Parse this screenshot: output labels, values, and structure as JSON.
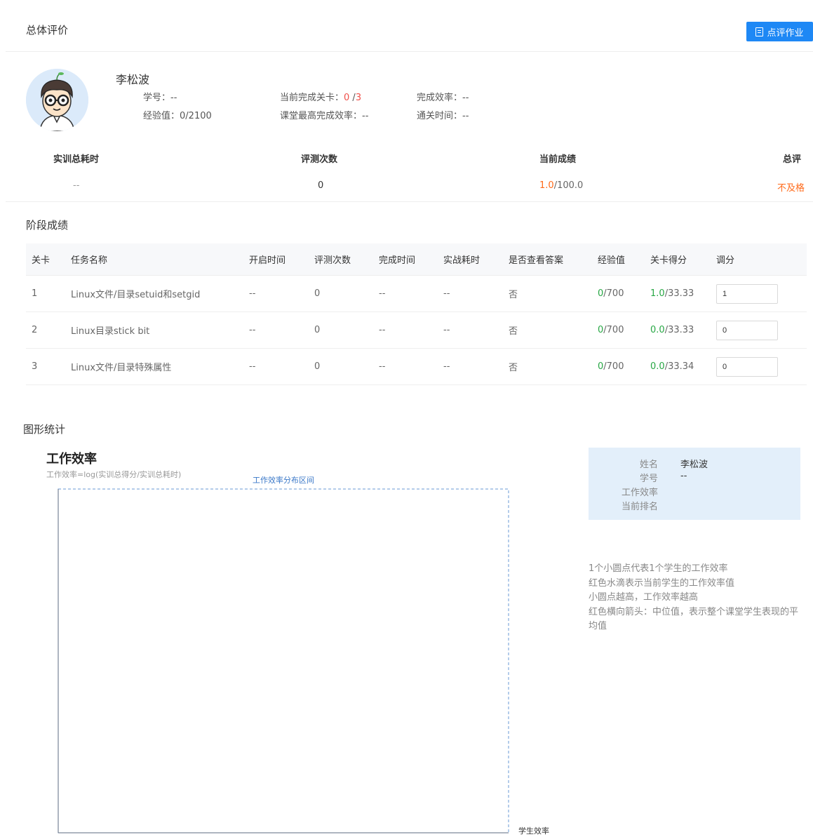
{
  "overview": {
    "title": "总体评价",
    "review_button": "点评作业"
  },
  "student": {
    "name": "李松波",
    "student_id_label": "学号：",
    "student_id": "--",
    "exp_label": "经验值：",
    "exp": "0/2100",
    "levels_label": "当前完成关卡：",
    "levels_done": "0",
    "levels_sep": " /",
    "levels_total": "3",
    "class_best_label": "课堂最高完成效率：",
    "class_best": "--",
    "efficiency_label": "完成效率：",
    "efficiency": "--",
    "pass_time_label": "通关时间：",
    "pass_time": "--"
  },
  "stats": {
    "total_time_label": "实训总耗时",
    "total_time": "--",
    "eval_count_label": "评测次数",
    "eval_count": "0",
    "score_label": "当前成绩",
    "score_current": "1.0",
    "score_total": "/100.0",
    "overall_label": "总评",
    "overall": "不及格"
  },
  "stage": {
    "title": "阶段成绩",
    "headers": [
      "关卡",
      "任务名称",
      "开启时间",
      "评测次数",
      "完成时间",
      "实战耗时",
      "是否查看答案",
      "经验值",
      "关卡得分",
      "调分"
    ],
    "rows": [
      {
        "no": "1",
        "name": "Linux文件/目录setuid和setgid",
        "open": "--",
        "evals": "0",
        "done": "--",
        "time": "--",
        "answer": "否",
        "exp_got": "0",
        "exp_total": "/700",
        "score_got": "1.0",
        "score_total": "/33.33",
        "adjust": "1"
      },
      {
        "no": "2",
        "name": "Linux目录stick bit",
        "open": "--",
        "evals": "0",
        "done": "--",
        "time": "--",
        "answer": "否",
        "exp_got": "0",
        "exp_total": "/700",
        "score_got": "0.0",
        "score_total": "/33.33",
        "adjust": "0"
      },
      {
        "no": "3",
        "name": "Linux文件/目录特殊属性",
        "open": "--",
        "evals": "0",
        "done": "--",
        "time": "--",
        "answer": "否",
        "exp_got": "0",
        "exp_total": "/700",
        "score_got": "0.0",
        "score_total": "/33.34",
        "adjust": "0"
      }
    ]
  },
  "graph": {
    "section_title": "图形统计",
    "title": "工作效率",
    "formula": "工作效率=log(实训总得分/实训总耗时)",
    "area_label": "工作效率分布区间",
    "x_label": "学生效率"
  },
  "card": {
    "name_label": "姓名",
    "name": "李松波",
    "id_label": "学号",
    "id": "--",
    "eff_label": "工作效率",
    "rank_label": "当前排名"
  },
  "legend": [
    "1个小圆点代表1个学生的工作效率",
    "红色水滴表示当前学生的工作效率值",
    "小圆点越高，工作效率越高",
    "红色横向箭头：中位值，表示整个课堂学生表现的平均值"
  ],
  "colors": {
    "primary": "#1e88f5",
    "danger": "#f0504a",
    "warning": "#ff6a1a",
    "success": "#28a745",
    "card_bg": "#e3effa"
  }
}
